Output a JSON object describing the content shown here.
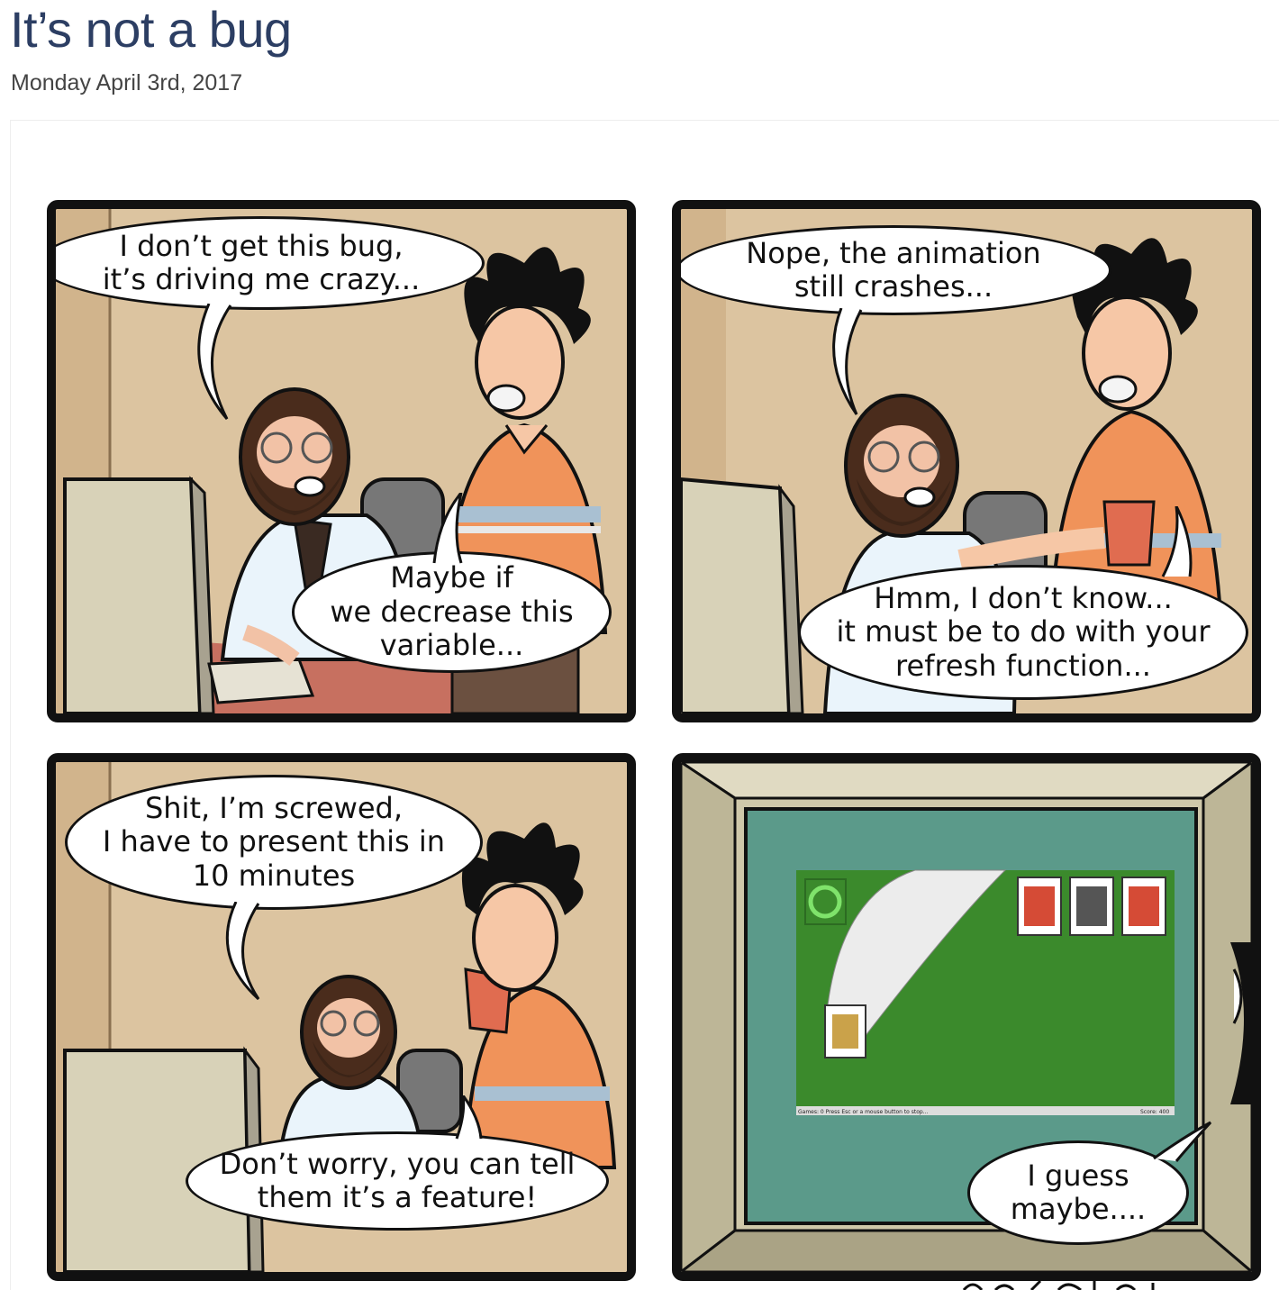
{
  "post": {
    "title": "It’s not a bug",
    "date": "Monday April 3rd, 2017"
  },
  "comic": {
    "panels": [
      {
        "bubbles": [
          "I don’t get this bug,\nit’s driving me crazy...",
          "Maybe if\nwe decrease this\nvariable..."
        ]
      },
      {
        "bubbles": [
          "Nope, the animation\nstill crashes...",
          "Hmm, I don’t know...\nit must be to do with your\nrefresh function..."
        ]
      },
      {
        "bubbles": [
          "Shit, I’m screwed,\nI have to present this in\n10 minutes",
          "Don’t worry, you can tell\nthem it’s a feature!"
        ]
      },
      {
        "bubbles": [
          "I guess\nmaybe...."
        ],
        "solitaire": {
          "status_left": "Games: 0   Press Esc or a mouse button to stop...",
          "status_right": "Score: 400"
        }
      }
    ]
  },
  "colors": {
    "title": "#2c3e63",
    "wall": "#dcc4a0",
    "shirt_orange": "#f0935a",
    "screen_teal": "#5b9a8a",
    "felt_green": "#3b8a2c"
  }
}
